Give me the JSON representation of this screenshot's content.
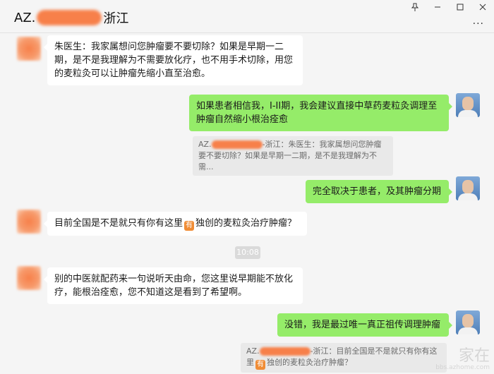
{
  "window": {
    "title_prefix": "AZ.",
    "title_suffix": "浙江",
    "pin_icon": "pin-icon",
    "minimize_icon": "minimize-icon",
    "maximize_icon": "maximize-icon",
    "close_icon": "close-icon",
    "more_label": "···"
  },
  "messages": [
    {
      "side": "left",
      "text": "朱医生：我家属想问您肿瘤要不要切除？如果是早期一二期，是不是我理解为不需要放化疗，也不用手术切除，用您的麦粒灸可以让肿瘤先缩小直至治愈。"
    },
    {
      "side": "right",
      "text": "如果患者相信我，I-II期，我会建议直接中草药麦粒灸调理至肿瘤自然缩小根治痊愈"
    },
    {
      "side": "quote",
      "prefix": "AZ.",
      "suffix": "-浙江：朱医生：我家属想问您肿瘤要不要切除？如果是早期一二期，是不是我理解为不需..."
    },
    {
      "side": "right",
      "text": "完全取决于患者，及其肿瘤分期"
    },
    {
      "side": "left",
      "text_before": "目前全国是不是就只有你有这里",
      "emoji": "有",
      "text_after": "独创的麦粒灸治疗肿瘤？"
    },
    {
      "side": "time",
      "text": "10:08"
    },
    {
      "side": "left",
      "text": "别的中医就配药来一句说听天由命，您这里说早期能不放化疗，能根治痊愈，您不知道这是看到了希望啊。"
    },
    {
      "side": "right",
      "text": "没错，我是最过唯一真正祖传调理肿瘤"
    },
    {
      "side": "quote",
      "prefix": "AZ.",
      "suffix_line1": "-浙江：目前全国是不是就只有你有这",
      "line2_before": "里",
      "emoji": "有",
      "line2_after": "独创的麦粒灸治疗肿瘤？"
    }
  ],
  "watermark": {
    "main": "家在",
    "sub": "bbs.azhome.com"
  }
}
